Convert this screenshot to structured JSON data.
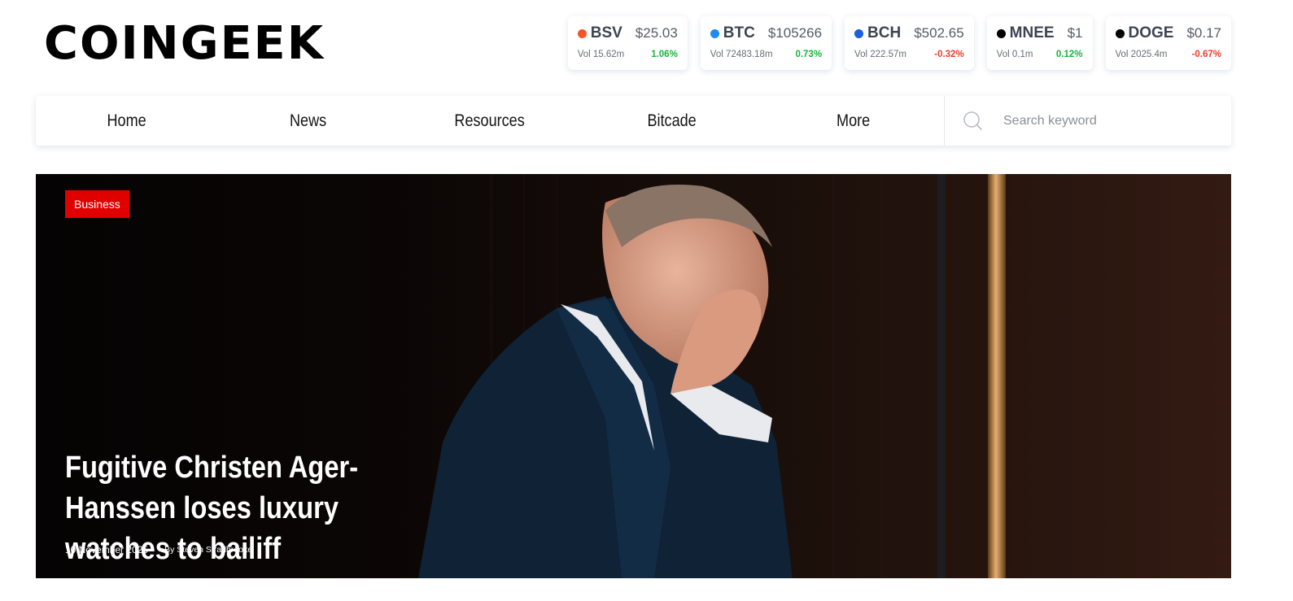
{
  "brand": {
    "logo_text": "COINGEEK"
  },
  "tickers": [
    {
      "symbol": "BSV",
      "price": "$25.03",
      "volume": "Vol 15.62m",
      "change": "1.06%",
      "direction": "up",
      "dot_color": "#f4552a"
    },
    {
      "symbol": "BTC",
      "price": "$105266",
      "volume": "Vol 72483.18m",
      "change": "0.73%",
      "direction": "up",
      "dot_color": "#1f8bf0"
    },
    {
      "symbol": "BCH",
      "price": "$502.65",
      "volume": "Vol 222.57m",
      "change": "-0.32%",
      "direction": "down",
      "dot_color": "#1a5fe0"
    },
    {
      "symbol": "MNEE",
      "price": "$1",
      "volume": "Vol 0.1m",
      "change": "0.12%",
      "direction": "up",
      "dot_color": "#000000"
    },
    {
      "symbol": "DOGE",
      "price": "$0.17",
      "volume": "Vol 2025.4m",
      "change": "-0.67%",
      "direction": "down",
      "dot_color": "#000000"
    }
  ],
  "nav": {
    "items": [
      {
        "label": "Home"
      },
      {
        "label": "News"
      },
      {
        "label": "Resources"
      },
      {
        "label": "Bitcade"
      },
      {
        "label": "More"
      }
    ],
    "search": {
      "placeholder": "Search keyword",
      "value": ""
    }
  },
  "hero": {
    "category": "Business",
    "headline": "Fugitive Christen Ager-Hanssen loses luxury watches to bailiff",
    "date": "10 November 2025",
    "author": "By Steven Stradbrooke"
  },
  "colors": {
    "up": "#17b33c",
    "down": "#ef3b2e",
    "badge": "#e00000"
  }
}
